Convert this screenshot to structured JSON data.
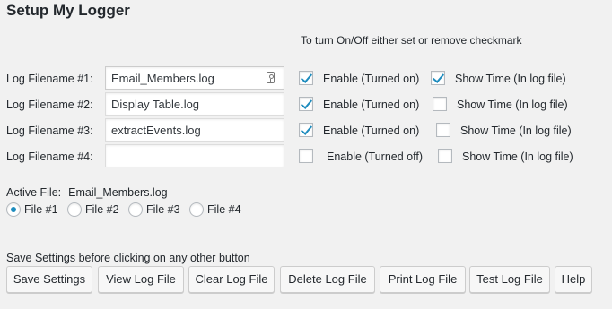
{
  "page": {
    "title": "Setup My Logger",
    "hint": "To turn On/Off either set or remove checkmark"
  },
  "logs": [
    {
      "label": "Log Filename #1:",
      "value": "Email_Members.log",
      "enabled": true,
      "enable_label": "Enable (Turned on)",
      "show_time": true,
      "show_time_label": "Show Time (In log file)"
    },
    {
      "label": "Log Filename #2:",
      "value": "Display Table.log",
      "enabled": true,
      "enable_label": "Enable (Turned on)",
      "show_time": false,
      "show_time_label": "Show Time (In log file)"
    },
    {
      "label": "Log Filename #3:",
      "value": "extractEvents.log",
      "enabled": true,
      "enable_label": "Enable (Turned on)",
      "show_time": false,
      "show_time_label": "Show Time (In log file)"
    },
    {
      "label": "Log Filename #4:",
      "value": "",
      "enabled": false,
      "enable_label": "Enable (Turned off)",
      "show_time": false,
      "show_time_label": "Show Time (In log file)"
    }
  ],
  "active_file": {
    "label": "Active File:",
    "value": "Email_Members.log",
    "options": [
      "File #1",
      "File #2",
      "File #3",
      "File #4"
    ],
    "selected_index": 0
  },
  "save_note": "Save Settings before clicking on any other button",
  "buttons": {
    "save": "Save Settings",
    "view": "View Log File",
    "clear": "Clear Log File",
    "delete": "Delete Log File",
    "print": "Print Log File",
    "test": "Test Log File",
    "help": "Help"
  },
  "colors": {
    "accent": "#1e8cbe",
    "background": "#f1f1f1"
  }
}
